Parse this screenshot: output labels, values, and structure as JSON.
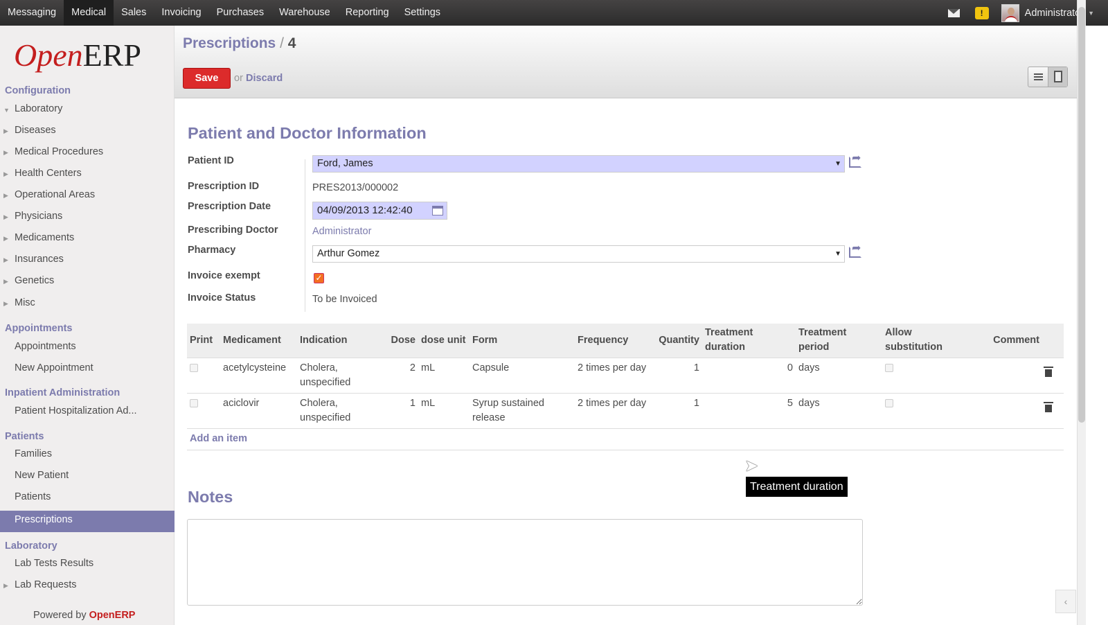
{
  "topnav": {
    "items": [
      "Messaging",
      "Medical",
      "Sales",
      "Invoicing",
      "Purchases",
      "Warehouse",
      "Reporting",
      "Settings"
    ],
    "active": "Medical",
    "user": "Administrator"
  },
  "sidebar": {
    "logo": {
      "open": "Open",
      "erp": "ERP"
    },
    "sections": [
      {
        "title": "Configuration",
        "items": [
          "Laboratory",
          "Diseases",
          "Medical Procedures",
          "Health Centers",
          "Operational Areas",
          "Physicians",
          "Medicaments",
          "Insurances",
          "Genetics",
          "Misc"
        ]
      },
      {
        "title": "Appointments",
        "items": [
          "Appointments",
          "New Appointment"
        ]
      },
      {
        "title": "Inpatient Administration",
        "items": [
          "Patient Hospitalization Ad..."
        ]
      },
      {
        "title": "Patients",
        "items": [
          "Families",
          "New Patient",
          "Patients",
          "Prescriptions"
        ]
      },
      {
        "title": "Laboratory",
        "items": [
          "Lab Tests Results",
          "Lab Requests"
        ]
      }
    ],
    "active_item": "Prescriptions",
    "powered_by": "Powered by",
    "powered_brand": "OpenERP"
  },
  "header": {
    "breadcrumb_link": "Prescriptions",
    "breadcrumb_sep": "/",
    "breadcrumb_current": "4",
    "save_label": "Save",
    "or_label": "or",
    "discard_label": "Discard"
  },
  "form": {
    "section_title": "Patient and Doctor Information",
    "patient_id_label": "Patient ID",
    "patient_id_value": "Ford, James",
    "prescription_id_label": "Prescription ID",
    "prescription_id_value": "PRES2013/000002",
    "prescription_date_label": "Prescription Date",
    "prescription_date_value": "04/09/2013 12:42:40",
    "doctor_label": "Prescribing Doctor",
    "doctor_value": "Administrator",
    "pharmacy_label": "Pharmacy",
    "pharmacy_value": "Arthur Gomez",
    "invoice_exempt_label": "Invoice exempt",
    "invoice_exempt_checked": true,
    "invoice_status_label": "Invoice Status",
    "invoice_status_value": "To be Invoiced",
    "notes_title": "Notes"
  },
  "table": {
    "columns": [
      "Print",
      "Medicament",
      "Indication",
      "Dose",
      "dose unit",
      "Form",
      "Frequency",
      "Quantity",
      "Treatment duration",
      "Treatment period",
      "Allow substitution",
      "Comment"
    ],
    "rows": [
      {
        "medicament": "acetylcysteine",
        "indication": "Cholera, unspecified",
        "dose": "2",
        "dose_unit": "mL",
        "form": "Capsule",
        "frequency": "2 times per day",
        "quantity": "1",
        "duration": "0",
        "period": "days"
      },
      {
        "medicament": "aciclovir",
        "indication": "Cholera, unspecified",
        "dose": "1",
        "dose_unit": "mL",
        "form": "Syrup sustained release",
        "frequency": "2 times per day",
        "quantity": "1",
        "duration": "5",
        "period": "days"
      }
    ],
    "add_item": "Add an item"
  },
  "tooltip": "Treatment duration"
}
